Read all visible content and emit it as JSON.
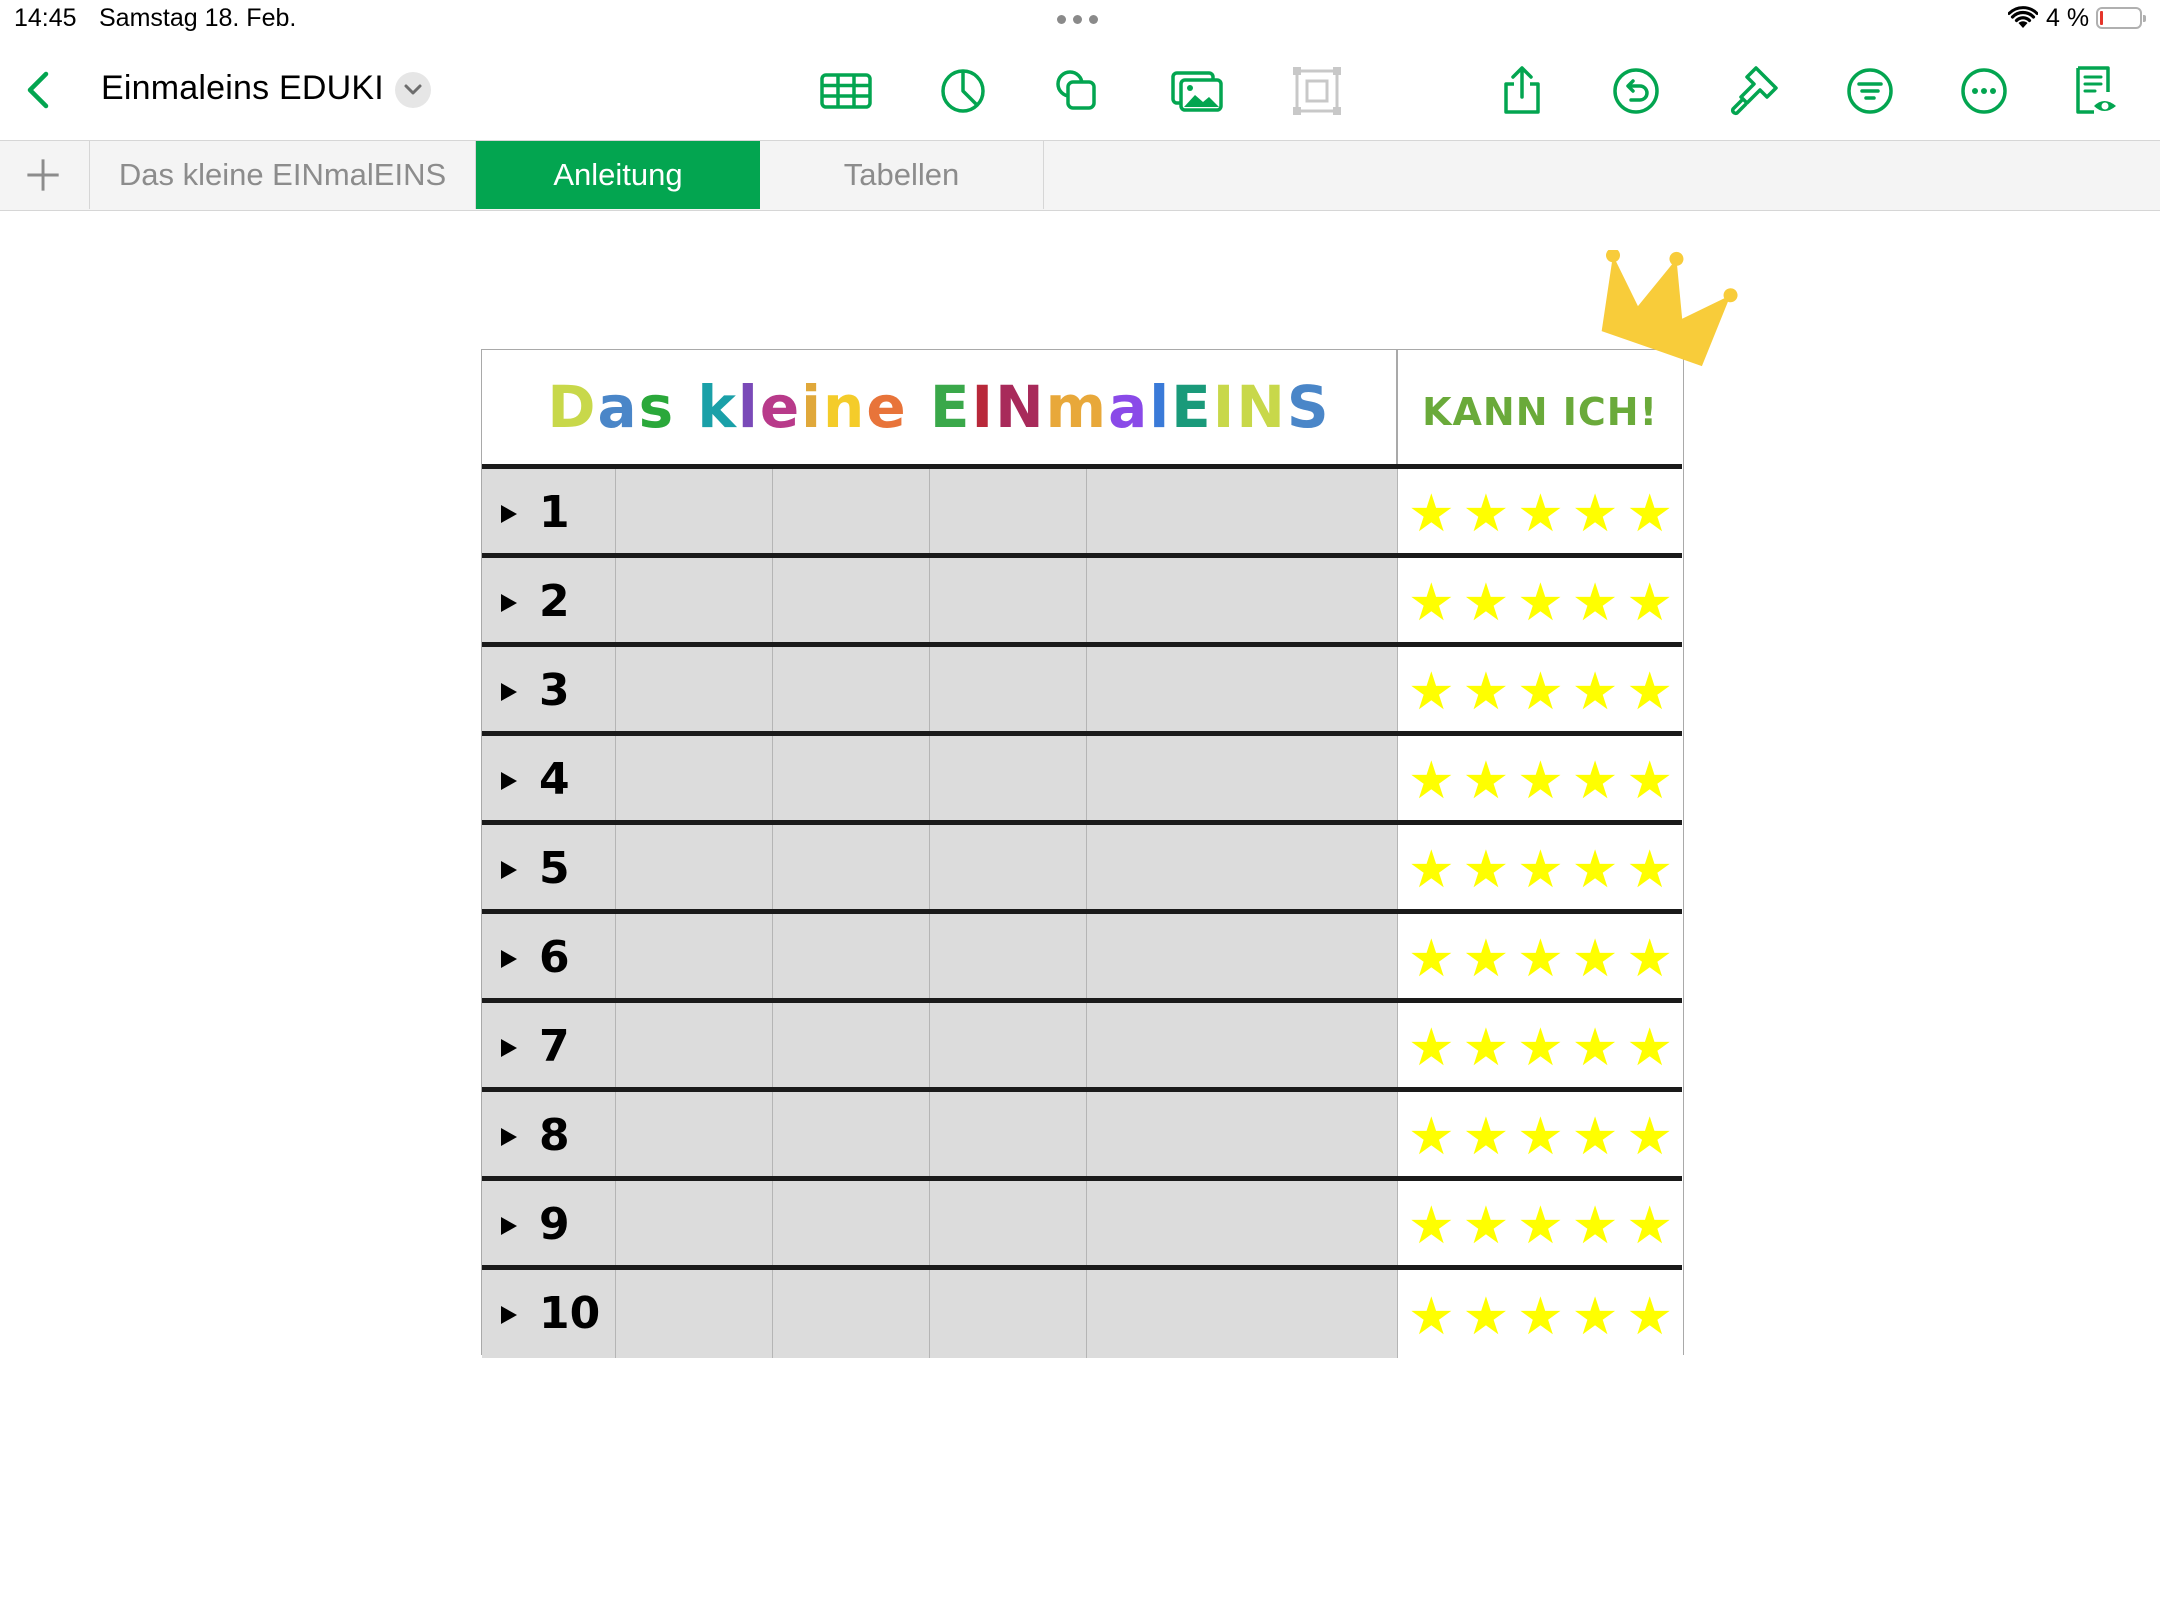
{
  "status_bar": {
    "time": "14:45",
    "date": "Samstag 18. Feb.",
    "battery": "4 %",
    "icons": [
      "wifi-icon",
      "battery-icon"
    ]
  },
  "toolbar": {
    "back_icon": "chevron-left-icon",
    "title": "Einmaleins EDUKI",
    "title_menu_icon": "chevron-down-icon",
    "buttons": [
      "table-icon",
      "chart-icon",
      "shape-icon",
      "media-icon",
      "text-box-icon",
      "share-icon",
      "undo-icon",
      "format-brush-icon",
      "organize-icon",
      "more-icon",
      "reader-view-icon"
    ]
  },
  "tabs": {
    "add_icon": "plus-icon",
    "items": [
      {
        "label": "Das kleine EINmalEINS",
        "active": false
      },
      {
        "label": "Anleitung",
        "active": true
      },
      {
        "label": "Tabellen",
        "active": false
      }
    ]
  },
  "worksheet": {
    "title": "Das kleine EINmalEINS",
    "title_colors": [
      "#c8d84a",
      "#4a86c8",
      "#2aa83a",
      "#1aa0a8",
      "#7a4ab8",
      "#b83a8a",
      "#e0a83a",
      "#f4cc2a",
      "#e8743a",
      "#3aa84a",
      "#b8283a",
      "#a82a5a",
      "#e8a83a",
      "#8a4ae8",
      "#3a7ad8",
      "#1a9a7a",
      "#c8d84a"
    ],
    "kann_label": "KANN ICH!",
    "row_numbers": [
      "1",
      "2",
      "3",
      "4",
      "5",
      "6",
      "7",
      "8",
      "9",
      "10"
    ],
    "stars_per_row": 5,
    "star_color": "#ffff00",
    "crown_color": "#f8cc3a"
  }
}
